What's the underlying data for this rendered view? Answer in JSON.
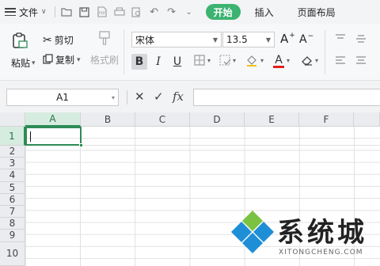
{
  "menubar": {
    "file_label": "文件",
    "tabs": [
      "开始",
      "插入",
      "页面布局"
    ],
    "active_tab_color": "#3cb371"
  },
  "ribbon": {
    "paste_label": "粘贴",
    "cut_label": "剪切",
    "copy_label": "复制",
    "format_painter_label": "格式刷",
    "font_name": "宋体",
    "font_size": "13.5",
    "bold": "B",
    "italic": "I",
    "underline": "U",
    "grow_font": "A",
    "shrink_font": "A",
    "font_color_glyph": "A",
    "font_color": "#e02020"
  },
  "formula_bar": {
    "name_box": "A1",
    "cancel": "✕",
    "confirm": "✓",
    "fx": "fx",
    "formula_value": ""
  },
  "sheet": {
    "columns": [
      "A",
      "B",
      "C",
      "D",
      "E",
      "F"
    ],
    "rows": [
      "1",
      "2",
      "3",
      "4",
      "5",
      "6",
      "7",
      "8",
      "9",
      "10"
    ],
    "active_cell": "A1",
    "accent": "#2e8b57"
  },
  "watermark": {
    "title": "系统城",
    "url": "XITONGCHENG.COM"
  }
}
